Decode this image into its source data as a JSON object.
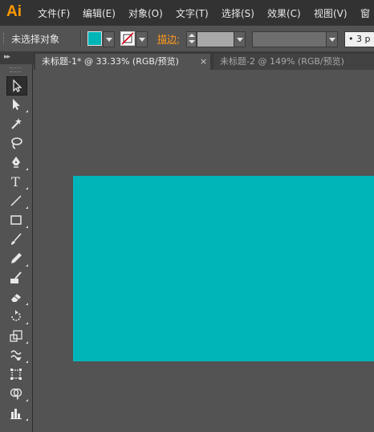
{
  "app": {
    "logo": "Ai"
  },
  "menu": {
    "items": [
      {
        "label": "文件(F)"
      },
      {
        "label": "编辑(E)"
      },
      {
        "label": "对象(O)"
      },
      {
        "label": "文字(T)"
      },
      {
        "label": "选择(S)"
      },
      {
        "label": "效果(C)"
      },
      {
        "label": "视图(V)"
      },
      {
        "label": "窗"
      }
    ]
  },
  "control_bar": {
    "selection_label": "未选择对象",
    "fill_color": "#00b5b8",
    "stroke_label": "描边:",
    "stroke_weight": "",
    "number_value": "• 3 p"
  },
  "tabs": [
    {
      "title": "未标题-1* @ 33.33% (RGB/预览)",
      "close": "×",
      "active": true
    },
    {
      "title": "未标题-2 @ 149% (RGB/预览)",
      "close": "×",
      "active": false
    }
  ],
  "tools": [
    {
      "name": "selection-tool"
    },
    {
      "name": "direct-selection-tool"
    },
    {
      "name": "magic-wand-tool"
    },
    {
      "name": "lasso-tool"
    },
    {
      "name": "pen-tool"
    },
    {
      "name": "type-tool",
      "glyph": "T"
    },
    {
      "name": "line-segment-tool"
    },
    {
      "name": "rectangle-tool"
    },
    {
      "name": "paintbrush-tool"
    },
    {
      "name": "pencil-tool"
    },
    {
      "name": "blob-brush-tool"
    },
    {
      "name": "eraser-tool"
    },
    {
      "name": "rotate-tool"
    },
    {
      "name": "scale-tool"
    },
    {
      "name": "warp-tool"
    },
    {
      "name": "free-transform-tool"
    },
    {
      "name": "shape-builder-tool"
    },
    {
      "name": "graph-tool"
    }
  ],
  "canvas": {
    "rect_color": "#00b5b8",
    "background": "#535353"
  }
}
